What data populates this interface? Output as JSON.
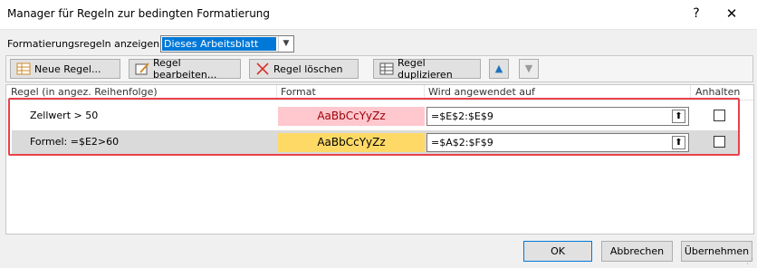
{
  "window": {
    "title": "Manager für Regeln zur bedingten Formatierung",
    "help": "?",
    "close": "✕"
  },
  "show_rules": {
    "label": "Formatierungsregeln anzeigen für:",
    "selected": "Dieses Arbeitsblatt"
  },
  "toolbar": {
    "new_rule": "Neue Regel...",
    "edit_rule": "Regel bearbeiten...",
    "delete_rule": "Regel löschen",
    "duplicate_rule": "Regel duplizieren",
    "move_up": "▲",
    "move_down": "▼"
  },
  "list": {
    "headers": {
      "rule": "Regel (in angez. Reihenfolge)",
      "format": "Format",
      "applies_to": "Wird angewendet auf",
      "stop": "Anhalten"
    },
    "rows": [
      {
        "rule": "Zellwert > 50",
        "format_preview": "AaBbCcYyZz",
        "applies_to": "=$E$2:$E$9",
        "stop_if_true": false,
        "format_bg": "#ffc7ce",
        "format_fg": "#9c0006"
      },
      {
        "rule": "Formel: =$E2>60",
        "format_preview": "AaBbCcYyZz",
        "applies_to": "=$A$2:$F$9",
        "stop_if_true": false,
        "format_bg": "#ffd966",
        "format_fg": "#000000"
      }
    ]
  },
  "buttons": {
    "ok": "OK",
    "cancel": "Abbrechen",
    "apply": "Übernehmen"
  },
  "colors": {
    "accent": "#0078d7",
    "highlight_border": "#e8424a"
  }
}
